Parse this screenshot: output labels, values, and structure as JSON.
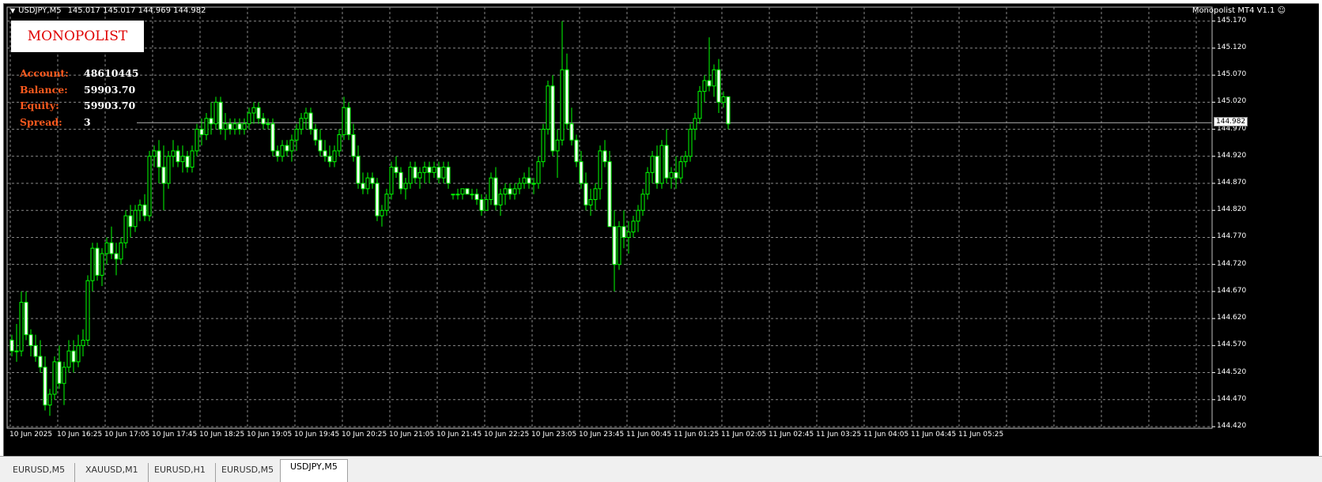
{
  "header": {
    "symbol": "USDJPY,M5",
    "ohlc": "145.017 145.017 144.969 144.982"
  },
  "indicator_name": "Monopolist MT4 V1.1",
  "logo_text": "MONOPOLIST",
  "account_panel": {
    "rows": [
      {
        "label": "Account:",
        "value": "48610445"
      },
      {
        "label": "Balance:",
        "value": "59903.70"
      },
      {
        "label": "Equity:",
        "value": "59903.70"
      },
      {
        "label": "Spread:",
        "value": "3"
      }
    ]
  },
  "current_price": "144.982",
  "price_axis": [
    "145.170",
    "145.120",
    "145.070",
    "145.020",
    "144.970",
    "144.920",
    "144.870",
    "144.820",
    "144.770",
    "144.720",
    "144.670",
    "144.620",
    "144.570",
    "144.520",
    "144.470",
    "144.420"
  ],
  "time_axis": [
    "10 Jun 2025",
    "10 Jun 16:25",
    "10 Jun 17:05",
    "10 Jun 17:45",
    "10 Jun 18:25",
    "10 Jun 19:05",
    "10 Jun 19:45",
    "10 Jun 20:25",
    "10 Jun 21:05",
    "10 Jun 21:45",
    "10 Jun 22:25",
    "10 Jun 23:05",
    "10 Jun 23:45",
    "11 Jun 00:45",
    "11 Jun 01:25",
    "11 Jun 02:05",
    "11 Jun 02:45",
    "11 Jun 03:25",
    "11 Jun 04:05",
    "11 Jun 04:45",
    "11 Jun 05:25"
  ],
  "tabs": [
    {
      "label": "EURUSD,M5",
      "active": false
    },
    {
      "label": "XAUUSD,M1",
      "active": false
    },
    {
      "label": "EURUSD,H1",
      "active": false
    },
    {
      "label": "EURUSD,M5",
      "active": false
    },
    {
      "label": "USDJPY,M5",
      "active": true
    }
  ],
  "colors": {
    "background": "#000000",
    "grid": "#8a8a8a",
    "candle": "#00ff00",
    "panel_label": "#ff5a1e",
    "logo": "#e00000"
  },
  "chart_data": {
    "type": "candlestick",
    "ylim": [
      144.42,
      145.19
    ],
    "candles": [
      [
        144.58,
        144.59,
        144.55,
        144.56
      ],
      [
        144.56,
        144.61,
        144.54,
        144.56
      ],
      [
        144.56,
        144.67,
        144.55,
        144.65
      ],
      [
        144.65,
        144.67,
        144.58,
        144.59
      ],
      [
        144.59,
        144.6,
        144.55,
        144.57
      ],
      [
        144.57,
        144.59,
        144.54,
        144.55
      ],
      [
        144.55,
        144.58,
        144.52,
        144.53
      ],
      [
        144.53,
        144.55,
        144.45,
        144.46
      ],
      [
        144.46,
        144.49,
        144.44,
        144.48
      ],
      [
        144.48,
        144.55,
        144.47,
        144.54
      ],
      [
        144.54,
        144.57,
        144.49,
        144.5
      ],
      [
        144.5,
        144.54,
        144.46,
        144.53
      ],
      [
        144.53,
        144.58,
        144.52,
        144.56
      ],
      [
        144.56,
        144.58,
        144.52,
        144.54
      ],
      [
        144.54,
        144.59,
        144.53,
        144.57
      ],
      [
        144.57,
        144.6,
        144.55,
        144.58
      ],
      [
        144.58,
        144.7,
        144.57,
        144.69
      ],
      [
        144.69,
        144.76,
        144.67,
        144.75
      ],
      [
        144.75,
        144.76,
        144.69,
        144.7
      ],
      [
        144.7,
        144.75,
        144.68,
        144.74
      ],
      [
        144.74,
        144.77,
        144.72,
        144.76
      ],
      [
        144.76,
        144.79,
        144.73,
        144.74
      ],
      [
        144.74,
        144.76,
        144.7,
        144.73
      ],
      [
        144.73,
        144.77,
        144.72,
        144.76
      ],
      [
        144.76,
        144.82,
        144.75,
        144.81
      ],
      [
        144.81,
        144.83,
        144.77,
        144.79
      ],
      [
        144.79,
        144.83,
        144.78,
        144.82
      ],
      [
        144.82,
        144.84,
        144.8,
        144.83
      ],
      [
        144.83,
        144.85,
        144.8,
        144.81
      ],
      [
        144.81,
        144.93,
        144.8,
        144.92
      ],
      [
        144.92,
        144.94,
        144.9,
        144.93
      ],
      [
        144.93,
        144.95,
        144.87,
        144.9
      ],
      [
        144.9,
        144.94,
        144.82,
        144.87
      ],
      [
        144.87,
        144.93,
        144.86,
        144.92
      ],
      [
        144.92,
        144.95,
        144.9,
        144.93
      ],
      [
        144.93,
        144.94,
        144.9,
        144.91
      ],
      [
        144.91,
        144.94,
        144.89,
        144.92
      ],
      [
        144.92,
        144.93,
        144.89,
        144.9
      ],
      [
        144.9,
        144.94,
        144.89,
        144.93
      ],
      [
        144.93,
        144.98,
        144.92,
        144.97
      ],
      [
        144.97,
        144.99,
        144.94,
        144.96
      ],
      [
        144.96,
        145.0,
        144.95,
        144.99
      ],
      [
        144.99,
        145.02,
        144.96,
        144.98
      ],
      [
        144.98,
        145.03,
        144.97,
        145.02
      ],
      [
        145.02,
        145.03,
        144.96,
        144.97
      ],
      [
        144.97,
        145.0,
        144.95,
        144.98
      ],
      [
        144.98,
        144.99,
        144.96,
        144.97
      ],
      [
        144.97,
        144.99,
        144.96,
        144.98
      ],
      [
        144.98,
        144.99,
        144.96,
        144.97
      ],
      [
        144.97,
        144.99,
        144.96,
        144.98
      ],
      [
        144.98,
        145.01,
        144.97,
        145.0
      ],
      [
        145.0,
        145.02,
        144.98,
        145.01
      ],
      [
        145.01,
        145.02,
        144.98,
        144.99
      ],
      [
        144.99,
        145.0,
        144.97,
        144.98
      ],
      [
        144.98,
        144.99,
        144.97,
        144.98
      ],
      [
        144.98,
        144.99,
        144.92,
        144.93
      ],
      [
        144.93,
        144.94,
        144.91,
        144.92
      ],
      [
        144.92,
        144.95,
        144.91,
        144.94
      ],
      [
        144.94,
        144.95,
        144.92,
        144.93
      ],
      [
        144.93,
        144.96,
        144.91,
        144.95
      ],
      [
        144.95,
        144.98,
        144.93,
        144.97
      ],
      [
        144.97,
        145.0,
        144.96,
        144.99
      ],
      [
        144.99,
        145.01,
        144.97,
        145.0
      ],
      [
        145.0,
        145.01,
        144.96,
        144.97
      ],
      [
        144.97,
        144.98,
        144.94,
        144.95
      ],
      [
        144.95,
        144.97,
        144.92,
        144.93
      ],
      [
        144.93,
        144.95,
        144.91,
        144.92
      ],
      [
        144.92,
        144.94,
        144.9,
        144.91
      ],
      [
        144.91,
        144.94,
        144.9,
        144.93
      ],
      [
        144.93,
        144.97,
        144.92,
        144.96
      ],
      [
        144.96,
        145.03,
        144.95,
        145.01
      ],
      [
        145.01,
        145.02,
        144.95,
        144.96
      ],
      [
        144.96,
        144.98,
        144.91,
        144.92
      ],
      [
        144.92,
        144.94,
        144.86,
        144.87
      ],
      [
        144.87,
        144.89,
        144.85,
        144.86
      ],
      [
        144.86,
        144.89,
        144.85,
        144.88
      ],
      [
        144.88,
        144.89,
        144.86,
        144.87
      ],
      [
        144.87,
        144.88,
        144.8,
        144.81
      ],
      [
        144.81,
        144.83,
        144.79,
        144.82
      ],
      [
        144.82,
        144.86,
        144.81,
        144.85
      ],
      [
        144.85,
        144.91,
        144.84,
        144.9
      ],
      [
        144.9,
        144.92,
        144.88,
        144.89
      ],
      [
        144.89,
        144.9,
        144.85,
        144.86
      ],
      [
        144.86,
        144.88,
        144.84,
        144.87
      ],
      [
        144.87,
        144.91,
        144.86,
        144.9
      ],
      [
        144.9,
        144.91,
        144.87,
        144.88
      ],
      [
        144.88,
        144.9,
        144.86,
        144.89
      ],
      [
        144.89,
        144.91,
        144.87,
        144.9
      ],
      [
        144.9,
        144.91,
        144.87,
        144.89
      ],
      [
        144.89,
        144.91,
        144.88,
        144.9
      ],
      [
        144.9,
        144.91,
        144.87,
        144.88
      ],
      [
        144.88,
        144.91,
        144.87,
        144.9
      ],
      [
        144.9,
        144.91,
        144.86,
        144.87
      ],
      [
        144.85,
        144.85,
        144.84,
        144.85
      ],
      [
        144.85,
        144.86,
        144.84,
        144.85
      ],
      [
        144.85,
        144.86,
        144.84,
        144.86
      ],
      [
        144.86,
        144.86,
        144.85,
        144.85
      ],
      [
        144.85,
        144.86,
        144.84,
        144.85
      ],
      [
        144.85,
        144.86,
        144.83,
        144.84
      ],
      [
        144.84,
        144.85,
        144.81,
        144.82
      ],
      [
        144.82,
        144.85,
        144.82,
        144.84
      ],
      [
        144.84,
        144.89,
        144.83,
        144.88
      ],
      [
        144.88,
        144.9,
        144.82,
        144.83
      ],
      [
        144.83,
        144.86,
        144.81,
        144.85
      ],
      [
        144.85,
        144.87,
        144.83,
        144.86
      ],
      [
        144.86,
        144.87,
        144.84,
        144.85
      ],
      [
        144.85,
        144.87,
        144.84,
        144.86
      ],
      [
        144.86,
        144.88,
        144.85,
        144.87
      ],
      [
        144.87,
        144.89,
        144.86,
        144.88
      ],
      [
        144.88,
        144.9,
        144.86,
        144.87
      ],
      [
        144.87,
        144.88,
        144.85,
        144.87
      ],
      [
        144.87,
        144.92,
        144.86,
        144.91
      ],
      [
        144.91,
        144.98,
        144.9,
        144.97
      ],
      [
        144.97,
        145.06,
        144.96,
        145.05
      ],
      [
        145.05,
        145.07,
        144.92,
        144.93
      ],
      [
        144.93,
        144.97,
        144.88,
        144.95
      ],
      [
        144.95,
        145.17,
        144.94,
        145.08
      ],
      [
        145.08,
        145.11,
        144.97,
        144.98
      ],
      [
        144.98,
        145.01,
        144.94,
        144.95
      ],
      [
        144.95,
        144.96,
        144.9,
        144.91
      ],
      [
        144.91,
        144.93,
        144.86,
        144.87
      ],
      [
        144.87,
        144.89,
        144.82,
        144.83
      ],
      [
        144.83,
        144.86,
        144.81,
        144.84
      ],
      [
        144.84,
        144.87,
        144.82,
        144.86
      ],
      [
        144.86,
        144.94,
        144.84,
        144.93
      ],
      [
        144.93,
        144.95,
        144.9,
        144.91
      ],
      [
        144.91,
        144.93,
        144.82,
        144.79
      ],
      [
        144.79,
        144.82,
        144.67,
        144.72
      ],
      [
        144.72,
        144.8,
        144.71,
        144.79
      ],
      [
        144.79,
        144.82,
        144.75,
        144.77
      ],
      [
        144.77,
        144.8,
        144.74,
        144.78
      ],
      [
        144.78,
        144.81,
        144.77,
        144.8
      ],
      [
        144.8,
        144.83,
        144.78,
        144.82
      ],
      [
        144.82,
        144.86,
        144.81,
        144.85
      ],
      [
        144.85,
        144.9,
        144.84,
        144.89
      ],
      [
        144.89,
        144.93,
        144.87,
        144.92
      ],
      [
        144.92,
        144.94,
        144.86,
        144.87
      ],
      [
        144.87,
        144.95,
        144.86,
        144.94
      ],
      [
        144.94,
        144.97,
        144.87,
        144.88
      ],
      [
        144.88,
        144.9,
        144.86,
        144.89
      ],
      [
        144.89,
        144.92,
        144.86,
        144.88
      ],
      [
        144.88,
        144.92,
        144.87,
        144.91
      ],
      [
        144.91,
        144.93,
        144.9,
        144.92
      ],
      [
        144.92,
        144.98,
        144.91,
        144.97
      ],
      [
        144.97,
        145.0,
        144.95,
        144.99
      ],
      [
        144.99,
        145.05,
        144.98,
        145.04
      ],
      [
        145.04,
        145.07,
        145.02,
        145.06
      ],
      [
        145.06,
        145.14,
        145.04,
        145.05
      ],
      [
        145.05,
        145.09,
        145.03,
        145.08
      ],
      [
        145.08,
        145.1,
        145.0,
        145.02
      ],
      [
        145.02,
        145.04,
        145.01,
        145.03
      ],
      [
        145.03,
        145.03,
        144.97,
        144.98
      ]
    ]
  }
}
